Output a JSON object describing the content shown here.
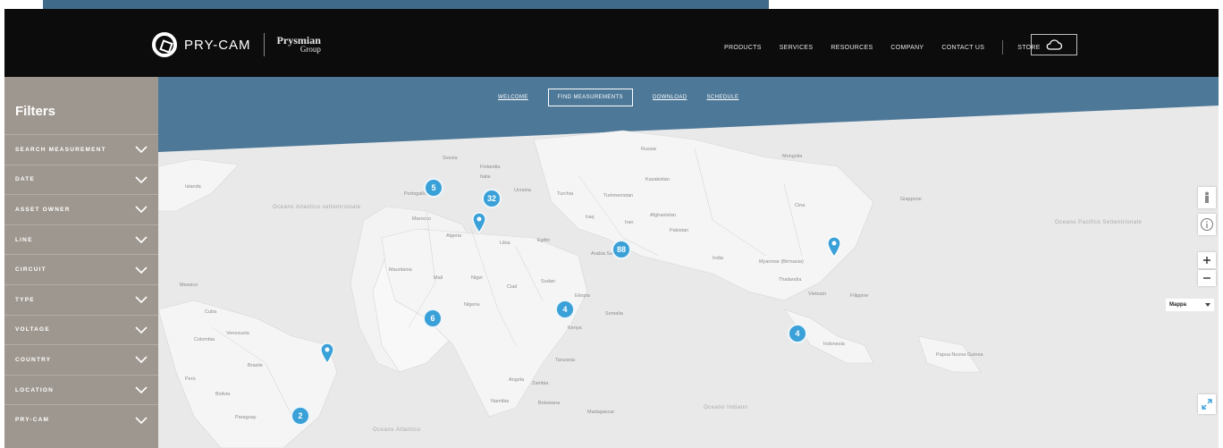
{
  "header": {
    "brand": "PRY-CAM",
    "group_line1": "Prysmian",
    "group_line2": "Group",
    "nav": [
      "PRODUCTS",
      "SERVICES",
      "RESOURCES",
      "COMPANY",
      "CONTACT US"
    ],
    "store": "STORE"
  },
  "sidebar": {
    "title": "Filters",
    "items": [
      "SEARCH MEASUREMENT",
      "DATE",
      "ASSET OWNER",
      "LINE",
      "CIRCUIT",
      "TYPE",
      "VOLTAGE",
      "COUNTRY",
      "LOCATION",
      "PRY-CAM"
    ]
  },
  "tabs": [
    "WELCOME",
    "FIND MEASUREMENTS",
    "DOWNLOAD",
    "SCHEDULE"
  ],
  "map": {
    "type_select": "Mappa",
    "clusters": [
      {
        "label": "5"
      },
      {
        "label": "32"
      },
      {
        "label": "88"
      },
      {
        "label": "4"
      },
      {
        "label": "6"
      },
      {
        "label": "4"
      },
      {
        "label": "2"
      }
    ],
    "ocean_labels": [
      "Oceano Atlantico settentrionale",
      "Oceano Pacifico Settentrionale",
      "Oceano Indiano",
      "Oceano Atlantico"
    ],
    "place_labels": [
      "Islanda",
      "Svezia",
      "Finlandia",
      "Russia",
      "Kazakistan",
      "Mongolia",
      "Portogallo",
      "Italia",
      "Ucraina",
      "Turchia",
      "Turkmenistan",
      "Marocco",
      "Algeria",
      "Libia",
      "Egitto",
      "Iraq",
      "Iran",
      "Afghanistan",
      "Pakistan",
      "Cina",
      "Giappone",
      "Arabia Saudita",
      "India",
      "Myanmar (Birmania)",
      "Thailandia",
      "Vietnam",
      "Filippine",
      "Mauritania",
      "Mali",
      "Niger",
      "Ciad",
      "Sudan",
      "Etiopia",
      "Nigeria",
      "Somalia",
      "Kenya",
      "Tanzania",
      "Angola",
      "Zambia",
      "Namibia",
      "Botswana",
      "Madagascar",
      "Indonesia",
      "Papua Nuova Guinea",
      "Brasile",
      "Perù",
      "Bolivia",
      "Paraguay",
      "Venezuela",
      "Colombia",
      "Messico",
      "Cuba"
    ]
  }
}
